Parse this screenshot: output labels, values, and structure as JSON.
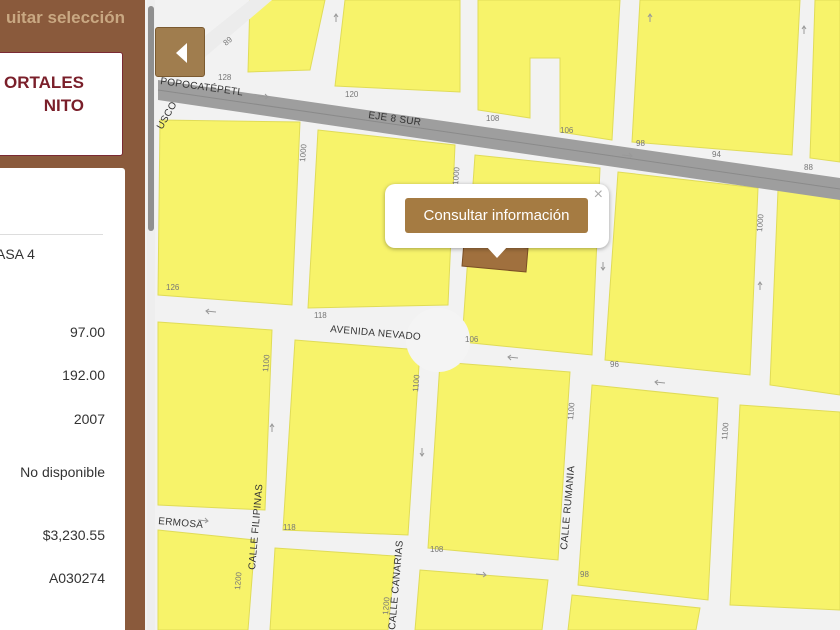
{
  "panel": {
    "header": "uitar selección",
    "title_lines": [
      "ORTALES",
      "NITO"
    ],
    "detail_left": "ASA 4",
    "values": [
      "97.00",
      "192.00",
      "2007",
      "No disponible",
      "$3,230.55",
      "A030274"
    ]
  },
  "popup": {
    "button_label": "Consultar información",
    "close_symbol": "×"
  },
  "map": {
    "streets": {
      "popocatepetl": "POPOCATÉPETL",
      "eje8": "EJE 8 SUR",
      "nevado": "AVENIDA NEVADO",
      "filipinas": "CALLE FILIPINAS",
      "rumania": "CALLE RUMANIA",
      "canarias": "CALLE CANARIAS",
      "hermosa": "ERMOSA",
      "usco": "USCO"
    },
    "numbers": {
      "n89": "89",
      "n128": "128",
      "n120": "120",
      "n108a": "108",
      "n106": "106",
      "n98": "98",
      "n94": "94",
      "n88": "88",
      "n1000a": "1000",
      "n1000b": "1000",
      "n1000c": "1000",
      "n126": "126",
      "n118": "118",
      "n106b": "106",
      "n96": "96",
      "n1100a": "1100",
      "n1100b": "1100",
      "n1100c": "1100",
      "n1100d": "1100",
      "n118b": "118",
      "n108b": "108",
      "n98b": "98",
      "n1200a": "1200",
      "n1200b": "1200"
    },
    "colors": {
      "block": "#f7f36a",
      "road": "#f4f4f4",
      "eje": "#9e9e9e",
      "parcel": "#a0703e"
    }
  }
}
